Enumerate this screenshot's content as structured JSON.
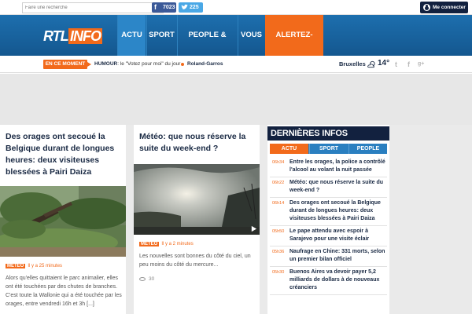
{
  "topbar": {
    "search_placeholder": "Faire une recherche",
    "facebook_count": "7023",
    "twitter_count": "225",
    "login_label": "Me connecter"
  },
  "header": {
    "logo_rtl": "RTL",
    "logo_info": "INFO",
    "nav": [
      "ACTU",
      "SPORT",
      "PEOPLE & BUZZ",
      "VOUS",
      "ALERTEZ-NOUS"
    ]
  },
  "ticker": {
    "badge": "EN CE MOMENT",
    "item1_category": "HUMOUR",
    "item1_text": ": le \"Votez pour moi\" du jour",
    "item2": "Roland-Garros",
    "city": "Bruxelles",
    "temperature": "14°"
  },
  "articles": [
    {
      "title": "Des orages ont secoué la Belgique durant de longues heures: deux visiteuses blessées à Pairi Daiza",
      "category": "MÉTÉO",
      "ago": "Il y a 25 minutes",
      "text": "Alors qu'elles quittaient le parc animalier, elles ont été touchées par des chutes de branches. C'est toute la Wallonie qui a été touchée par les orages, entre vendredi 16h et 3h [...]"
    },
    {
      "title": "Météo: que nous réserve la suite du week-end ?",
      "category": "MÉTÉO",
      "ago": "Il y a 2 minutes",
      "text": "Les nouvelles sont bonnes du côté du ciel, un peu moins du côté du mercure...",
      "comments": "30"
    }
  ],
  "sidebar": {
    "title": "DERNIÈRES INFOS",
    "tabs": [
      "ACTU",
      "SPORT",
      "PEOPLE"
    ],
    "items": [
      {
        "time": "06h34",
        "text": "Entre les orages, la police a contrôlé l'alcool au volant la nuit passée"
      },
      {
        "time": "06h22",
        "text": "Météo: que nous réserve la suite du week-end ?"
      },
      {
        "time": "06h14",
        "text": "Des orages ont secoué la Belgique durant de longues heures: deux visiteuses blessées à Pairi Daiza"
      },
      {
        "time": "05h50",
        "text": "Le pape attendu avec espoir à Sarajevo pour une visite éclair"
      },
      {
        "time": "05h36",
        "text": "Naufrage en Chine: 331 morts, selon un premier bilan officiel"
      },
      {
        "time": "05h30",
        "text": "Buenos Aires va devoir payer 5,2 milliards de dollars à de nouveaux créanciers"
      }
    ]
  }
}
